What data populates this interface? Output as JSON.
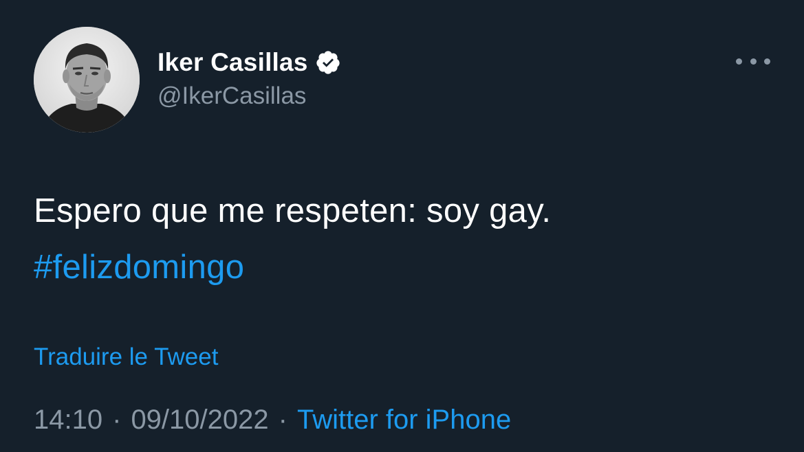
{
  "author": {
    "display_name": "Iker Casillas",
    "handle": "@IkerCasillas",
    "verified": true,
    "avatar_icon": "profile-photo"
  },
  "tweet": {
    "text": "Espero que me respeten: soy gay.",
    "hashtag": "#felizdomingo",
    "translate_label": "Traduire le Tweet"
  },
  "meta": {
    "time": "14:10",
    "separator": "·",
    "date": "09/10/2022",
    "source": "Twitter for iPhone"
  },
  "menu": {
    "icon": "more-horizontal-icon"
  },
  "colors": {
    "background": "#15202b",
    "text_primary": "#ffffff",
    "text_secondary": "#8b98a5",
    "accent": "#1d9bf0"
  }
}
